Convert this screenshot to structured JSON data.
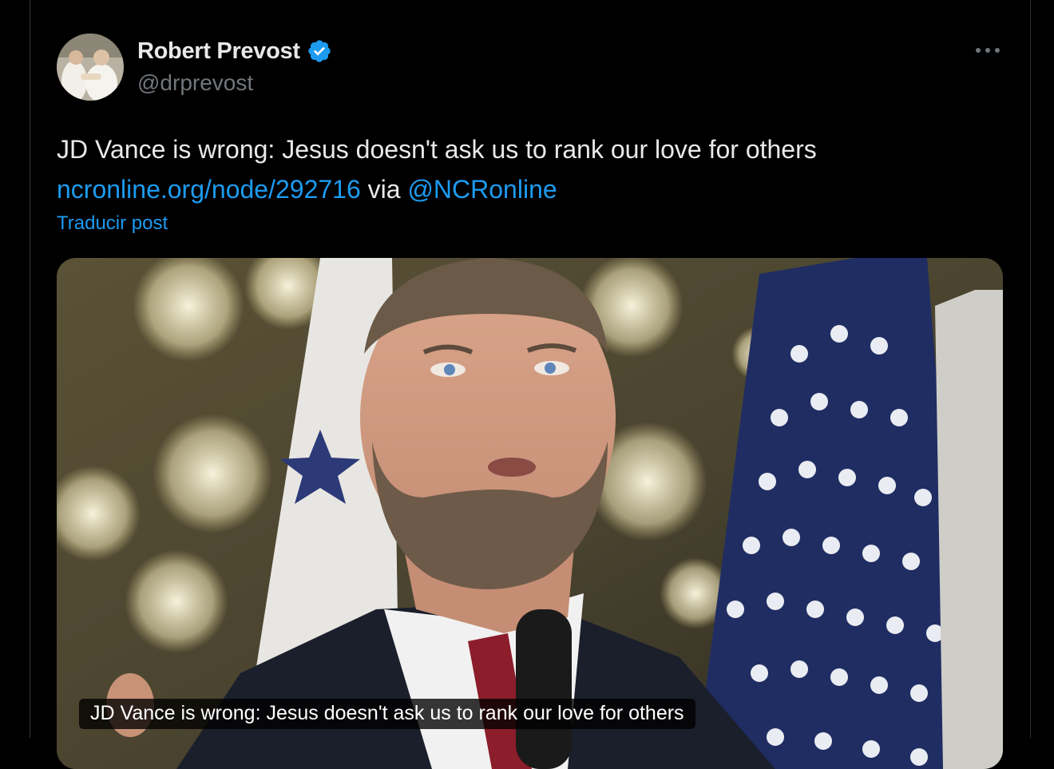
{
  "author": {
    "display_name": "Robert Prevost",
    "handle": "@drprevost",
    "verified": true
  },
  "post": {
    "text": "JD Vance is wrong: Jesus doesn't ask us to rank our love for others",
    "link_url": "ncronline.org/node/292716",
    "via_word": "via",
    "mention": "@NCRonline",
    "translate_label": "Traducir post"
  },
  "media": {
    "caption": "JD Vance is wrong: Jesus doesn't ask us to rank our love for others"
  },
  "icons": {
    "verified": "verified-badge-icon",
    "more": "more-options-icon"
  },
  "colors": {
    "background": "#000000",
    "text": "#e7e9ea",
    "secondary_text": "#71767b",
    "link": "#1d9bf0",
    "verified_badge": "#1d9bf0"
  }
}
